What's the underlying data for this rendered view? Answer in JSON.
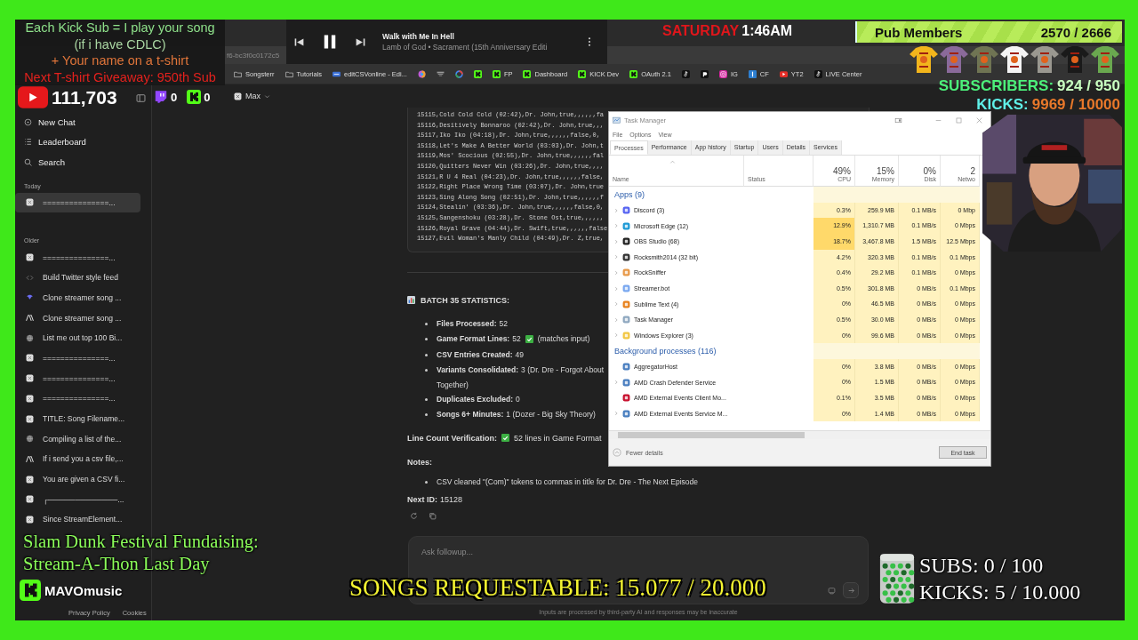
{
  "promo_panel": {
    "lines": [
      {
        "text": "Each Kick Sub = I play your song",
        "color": "#8ee08a"
      },
      {
        "text": "(if i have CDLC)",
        "color": "#a9d6a2"
      },
      {
        "text": "+ Your name on a t-shirt",
        "color": "#e0753a"
      },
      {
        "text": "Next T-shirt Giveaway: 950th Sub",
        "color": "#e3211d"
      }
    ]
  },
  "stream_counters": {
    "youtube": "111,703",
    "twitch": "0",
    "kick": "0"
  },
  "media_player": {
    "title": "Walk with Me In Hell",
    "subtitle": "Lamb of God • Sacrament (15th Anniversary Editi",
    "playing": true
  },
  "clock": {
    "day": "SATURDAY",
    "time": "1:46AM"
  },
  "pub_members": {
    "label": "Pub Members",
    "count": "2570 / 2666"
  },
  "goals": {
    "subscribers_label": "SUBSCRIBERS:",
    "subscribers": "924 / 950",
    "kicks_label": "KICKS:",
    "kicks": "9969 / 10000"
  },
  "browser": {
    "url": "f6-bc3f0c0172c5",
    "bookmarks": [
      {
        "kind": "folder",
        "label": "Songsterr"
      },
      {
        "kind": "folder",
        "label": "Tutorials"
      },
      {
        "kind": "file",
        "label": "editCSVonline - Edi..."
      },
      {
        "kind": "swirl"
      },
      {
        "kind": "tray"
      },
      {
        "kind": "globe"
      },
      {
        "kind": "kick"
      },
      {
        "kind": "kick",
        "label": "FP"
      },
      {
        "kind": "kick",
        "label": "Dashboard"
      },
      {
        "kind": "kick",
        "label": "KICK Dev"
      },
      {
        "kind": "kick",
        "label": "OAuth 2.1"
      },
      {
        "kind": "note"
      },
      {
        "kind": "square"
      },
      {
        "kind": "camera",
        "label": "IG"
      },
      {
        "kind": "bar",
        "label": "CF"
      },
      {
        "kind": "play",
        "label": "YT2"
      },
      {
        "kind": "note",
        "label": "LIVE Center"
      }
    ]
  },
  "model_selector": {
    "label": "Max"
  },
  "sidebar": {
    "actions": [
      {
        "kind": "new",
        "label": "New Chat"
      },
      {
        "kind": "list",
        "label": "Leaderboard"
      },
      {
        "kind": "search",
        "label": "Search"
      }
    ],
    "sections": [
      {
        "title": "Today",
        "items": [
          {
            "kind": "box",
            "label": "===============...",
            "selected": true
          }
        ]
      },
      {
        "title": "Older",
        "items": [
          {
            "kind": "box",
            "label": "===============...",
            "selected": false
          },
          {
            "kind": "code",
            "label": "Build Twitter style feed",
            "selected": false
          },
          {
            "kind": "swirl",
            "label": "Clone streamer song ...",
            "selected": false
          },
          {
            "kind": "peak",
            "label": "Clone streamer song ...",
            "selected": false
          },
          {
            "kind": "globe",
            "label": "List me out top 100 Bi...",
            "selected": false
          },
          {
            "kind": "box",
            "label": "===============...",
            "selected": false
          },
          {
            "kind": "box",
            "label": "===============...",
            "selected": false
          },
          {
            "kind": "box",
            "label": "===============...",
            "selected": false
          },
          {
            "kind": "box",
            "label": "TITLE: Song Filename...",
            "selected": false
          },
          {
            "kind": "globe",
            "label": "Compiling a list of the...",
            "selected": false
          },
          {
            "kind": "peak",
            "label": "If i send you a csv file,...",
            "selected": false
          },
          {
            "kind": "box",
            "label": "You are given a CSV fi...",
            "selected": false
          },
          {
            "kind": "box",
            "label": "┌─────────────...",
            "selected": false
          },
          {
            "kind": "box",
            "label": "Since StreamElement...",
            "selected": false
          }
        ]
      }
    ],
    "footer_links": [
      "Privacy Policy",
      "Cookies"
    ]
  },
  "chat": {
    "code_lines": [
      "15115,Cold Cold Cold (02:42),Dr. John,true,,,,,,fa",
      "15116,Desitively Bonnaroo (02:42),Dr. John,true,,,",
      "15117,Iko Iko (04:18),Dr. John,true,,,,,,false,0,",
      "15118,Let's Make A Better World (03:03),Dr. John,t",
      "15119,Mos' Scocious (02:55),Dr. John,true,,,,,,fal",
      "15120,Quitters Never Win (03:26),Dr. John,true,,,,",
      "15121,R U 4 Real (04:23),Dr. John,true,,,,,,false,",
      "15122,Right Place Wrong Time (03:07),Dr. John,true",
      "15123,Sing Along Song (02:51),Dr. John,true,,,,,,f",
      "15124,Stealin' (03:36),Dr. John,true,,,,,,false,0,",
      "15125,Sangenshoku (03:28),Dr. Stone Ost,true,,,,,,",
      "15126,Royal Grave (04:44),Dr. Swift,true,,,,,,false",
      "15127,Evil Woman's Manly Child (04:49),Dr. Z,true,"
    ],
    "stats_heading": "BATCH 35 STATISTICS:",
    "stats": [
      {
        "label": "Files Processed:",
        "value": "52",
        "check": false
      },
      {
        "label": "Game Format Lines:",
        "value": "52",
        "check": true,
        "note": "(matches input)"
      },
      {
        "label": "CSV Entries Created:",
        "value": "49",
        "check": false
      },
      {
        "label": "Variants Consolidated:",
        "value": "3 (Dr. Dre - Forgot About",
        "check": false,
        "continuation": "Together)"
      },
      {
        "label": "Duplicates Excluded:",
        "value": "0",
        "check": false
      },
      {
        "label": "Songs 6+ Minutes:",
        "value": "1 (Dozer - Big Sky Theory)",
        "check": false
      }
    ],
    "verification": {
      "label": "Line Count Verification:",
      "check": true,
      "value": "52 lines in Game Format"
    },
    "notes_label": "Notes:",
    "notes": [
      "CSV cleaned \"(Com)\" tokens to commas in title for Dr. Dre - The Next Episode"
    ],
    "next_id": {
      "label": "Next ID:",
      "value": "15128"
    },
    "input": {
      "placeholder": "Ask followup..."
    },
    "disclaimer": "Inputs are processed by third-party AI and responses may be inaccurate"
  },
  "task_manager": {
    "title": "Task Manager",
    "menu": [
      "File",
      "Options",
      "View"
    ],
    "tabs": [
      {
        "label": "Processes",
        "selected": true
      },
      {
        "label": "Performance",
        "selected": false
      },
      {
        "label": "App history",
        "selected": false
      },
      {
        "label": "Startup",
        "selected": false
      },
      {
        "label": "Users",
        "selected": false
      },
      {
        "label": "Details",
        "selected": false
      },
      {
        "label": "Services",
        "selected": false
      }
    ],
    "columns": [
      {
        "label": "Name"
      },
      {
        "label": "Status"
      },
      {
        "percent": "49%",
        "label": "CPU"
      },
      {
        "percent": "15%",
        "label": "Memory"
      },
      {
        "percent": "0%",
        "label": "Disk"
      },
      {
        "percent": "2",
        "label": "Netwo"
      }
    ],
    "groups": [
      {
        "title": "Apps (9)",
        "rows": [
          {
            "name": "Discord (3)",
            "color": "#5865f2",
            "expandable": true,
            "cpu_high": false,
            "cpu": "0.3%",
            "memory": "259.9 MB",
            "disk": "0.1 MB/s",
            "network": "0 Mbp"
          },
          {
            "name": "Microsoft Edge (12)",
            "color": "#1f9ad6",
            "expandable": true,
            "cpu_high": true,
            "cpu": "12.9%",
            "memory": "1,310.7 MB",
            "disk": "0.1 MB/s",
            "network": "0 Mbps"
          },
          {
            "name": "OBS Studio (68)",
            "color": "#222222",
            "expandable": true,
            "cpu_high": true,
            "cpu": "18.7%",
            "memory": "3,467.8 MB",
            "disk": "1.5 MB/s",
            "network": "12.5 Mbps"
          },
          {
            "name": "Rocksmith2014 (32 bit)",
            "color": "#333333",
            "expandable": true,
            "cpu_high": false,
            "cpu": "4.2%",
            "memory": "320.3 MB",
            "disk": "0.1 MB/s",
            "network": "0.1 Mbps"
          },
          {
            "name": "RockSniffer",
            "color": "#e89a4a",
            "expandable": true,
            "cpu_high": false,
            "cpu": "0.4%",
            "memory": "29.2 MB",
            "disk": "0.1 MB/s",
            "network": "0 Mbps"
          },
          {
            "name": "Streamer.bot",
            "color": "#7aa8f0",
            "expandable": true,
            "cpu_high": false,
            "cpu": "0.5%",
            "memory": "301.8 MB",
            "disk": "0 MB/s",
            "network": "0.1 Mbps"
          },
          {
            "name": "Sublime Text (4)",
            "color": "#e8821e",
            "expandable": true,
            "cpu_high": false,
            "cpu": "0%",
            "memory": "46.5 MB",
            "disk": "0 MB/s",
            "network": "0 Mbps"
          },
          {
            "name": "Task Manager",
            "color": "#8fa8c0",
            "expandable": true,
            "cpu_high": false,
            "cpu": "0.5%",
            "memory": "30.0 MB",
            "disk": "0 MB/s",
            "network": "0 Mbps"
          },
          {
            "name": "Windows Explorer (3)",
            "color": "#f2c744",
            "expandable": true,
            "cpu_high": false,
            "cpu": "0%",
            "memory": "99.6 MB",
            "disk": "0 MB/s",
            "network": "0 Mbps"
          }
        ]
      },
      {
        "title": "Background processes (116)",
        "rows": [
          {
            "name": "AggregatorHost",
            "color": "#4a7fc0",
            "expandable": false,
            "cpu_high": false,
            "cpu": "0%",
            "memory": "3.8 MB",
            "disk": "0 MB/s",
            "network": "0 Mbps"
          },
          {
            "name": "AMD Crash Defender Service",
            "color": "#4a7fc0",
            "expandable": true,
            "cpu_high": false,
            "cpu": "0%",
            "memory": "1.5 MB",
            "disk": "0 MB/s",
            "network": "0 Mbps"
          },
          {
            "name": "AMD External Events Client Mo...",
            "color": "#c8102e",
            "expandable": false,
            "cpu_high": false,
            "cpu": "0.1%",
            "memory": "3.5 MB",
            "disk": "0 MB/s",
            "network": "0 Mbps"
          },
          {
            "name": "AMD External Events Service M...",
            "color": "#4a7fc0",
            "expandable": true,
            "cpu_high": false,
            "cpu": "0%",
            "memory": "1.4 MB",
            "disk": "0 MB/s",
            "network": "0 Mbps"
          }
        ]
      }
    ],
    "fewer_details": "Fewer details",
    "end_task": "End task"
  },
  "fundraiser": {
    "lines": [
      "Slam Dunk Festival Fundaising:",
      "Stream-A-Thon Last Day"
    ]
  },
  "channel_name": "MAVOmusic",
  "songs_requestable": "SONGS REQUESTABLE: 15.077 / 20.000",
  "jar_goals": [
    "SUBS: 0 / 100",
    "KICKS: 5 / 10.000"
  ]
}
